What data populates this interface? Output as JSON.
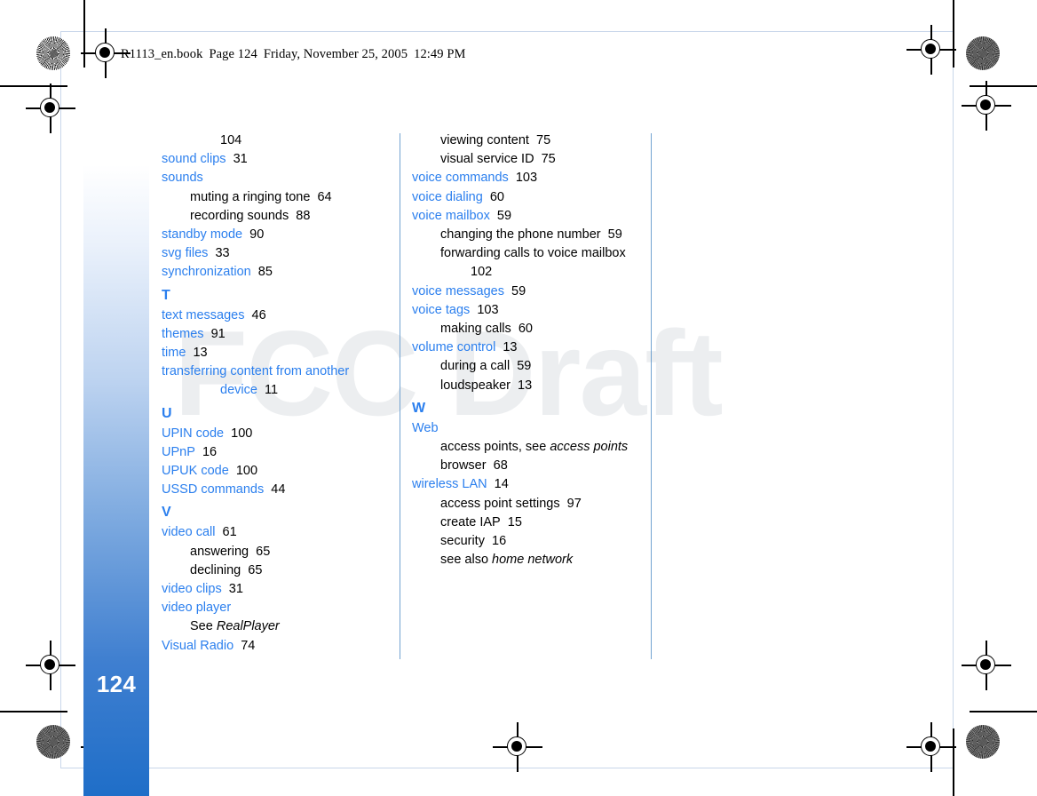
{
  "document": {
    "header": {
      "filename": "R1113_en.book",
      "page_label": "Page 124",
      "date": "Friday, November 25, 2005",
      "time": "12:49 PM"
    },
    "page_number": "124",
    "watermark": "FCC Draft"
  },
  "columns": {
    "left": [
      {
        "type": "cont",
        "text": "104"
      },
      {
        "type": "head",
        "text": "sound clips",
        "page": "31"
      },
      {
        "type": "head",
        "text": "sounds",
        "page": ""
      },
      {
        "type": "sub",
        "text": "muting a ringing tone",
        "page": "64"
      },
      {
        "type": "sub",
        "text": "recording sounds",
        "page": "88"
      },
      {
        "type": "head",
        "text": "standby mode",
        "page": "90"
      },
      {
        "type": "head",
        "text": "svg files",
        "page": "33"
      },
      {
        "type": "head",
        "text": "synchronization",
        "page": "85"
      },
      {
        "type": "letter",
        "text": "T"
      },
      {
        "type": "head",
        "text": "text messages",
        "page": "46"
      },
      {
        "type": "head",
        "text": "themes",
        "page": "91"
      },
      {
        "type": "head",
        "text": "time",
        "page": "13"
      },
      {
        "type": "head",
        "text": "transferring content from another",
        "page": ""
      },
      {
        "type": "headcont",
        "text": "device",
        "page": "11"
      },
      {
        "type": "letter",
        "text": "U"
      },
      {
        "type": "head",
        "text": "UPIN code",
        "page": "100"
      },
      {
        "type": "head",
        "text": "UPnP",
        "page": "16"
      },
      {
        "type": "head",
        "text": "UPUK code",
        "page": "100"
      },
      {
        "type": "head",
        "text": "USSD commands",
        "page": "44"
      },
      {
        "type": "letter",
        "text": "V"
      },
      {
        "type": "head",
        "text": "video call",
        "page": "61"
      },
      {
        "type": "sub",
        "text": "answering",
        "page": "65"
      },
      {
        "type": "sub",
        "text": "declining",
        "page": "65"
      },
      {
        "type": "head",
        "text": "video clips",
        "page": "31"
      },
      {
        "type": "head",
        "text": "video player",
        "page": ""
      },
      {
        "type": "sub",
        "text": "See ",
        "italic": "RealPlayer",
        "page": ""
      },
      {
        "type": "head",
        "text": "Visual Radio",
        "page": "74"
      }
    ],
    "right": [
      {
        "type": "sub",
        "text": "viewing content",
        "page": "75"
      },
      {
        "type": "sub",
        "text": "visual service ID",
        "page": "75"
      },
      {
        "type": "head",
        "text": "voice commands",
        "page": "103"
      },
      {
        "type": "head",
        "text": "voice dialing",
        "page": "60"
      },
      {
        "type": "head",
        "text": "voice mailbox",
        "page": "59"
      },
      {
        "type": "sub",
        "text": "changing the phone number",
        "page": "59"
      },
      {
        "type": "sub",
        "text": "forwarding calls to voice mailbox",
        "page": ""
      },
      {
        "type": "cont",
        "text": "102"
      },
      {
        "type": "head",
        "text": "voice messages",
        "page": "59"
      },
      {
        "type": "head",
        "text": "voice tags",
        "page": "103"
      },
      {
        "type": "sub",
        "text": "making calls",
        "page": "60"
      },
      {
        "type": "head",
        "text": "volume control",
        "page": "13"
      },
      {
        "type": "sub",
        "text": "during a call",
        "page": "59"
      },
      {
        "type": "sub",
        "text": "loudspeaker",
        "page": "13"
      },
      {
        "type": "letter",
        "text": "W"
      },
      {
        "type": "head",
        "text": "Web",
        "page": ""
      },
      {
        "type": "sub",
        "text": "access points, see ",
        "italic": "access points",
        "page": ""
      },
      {
        "type": "sub",
        "text": "browser",
        "page": "68"
      },
      {
        "type": "head",
        "text": "wireless LAN",
        "page": "14"
      },
      {
        "type": "sub",
        "text": "access point settings",
        "page": "97"
      },
      {
        "type": "sub",
        "text": "create IAP",
        "page": "15"
      },
      {
        "type": "sub",
        "text": "security",
        "page": "16"
      },
      {
        "type": "sub",
        "text": "see also ",
        "italic": "home network",
        "page": ""
      }
    ]
  },
  "colors": {
    "entry_blue": "#2b7fee",
    "page_band_blue": "#1f6ec8",
    "watermark_gray": "#eceef0",
    "column_rule": "#5b93c9"
  }
}
